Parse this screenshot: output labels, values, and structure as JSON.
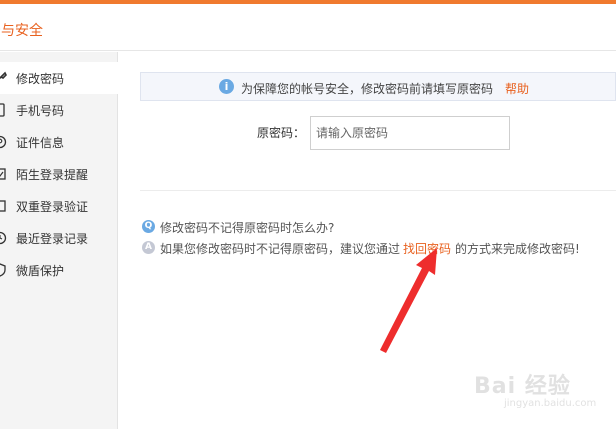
{
  "header": {
    "title": "号与安全"
  },
  "sidebar": {
    "items": [
      {
        "label": "修改密码",
        "icon": "wrench-icon",
        "active": true
      },
      {
        "label": "手机号码",
        "icon": "phone-icon"
      },
      {
        "label": "证件信息",
        "icon": "id-icon"
      },
      {
        "label": "陌生登录提醒",
        "icon": "alert-icon"
      },
      {
        "label": "双重登录验证",
        "icon": "double-verify-icon"
      },
      {
        "label": "最近登录记录",
        "icon": "clock-icon"
      },
      {
        "label": "微盾保护",
        "icon": "shield-icon"
      }
    ]
  },
  "notice": {
    "icon_glyph": "i",
    "text": "为保障您的帐号安全，修改密码前请填写原密码",
    "help_link": "帮助"
  },
  "form": {
    "old_password_label": "原密码：",
    "old_password_placeholder": "请输入原密码",
    "old_password_value": ""
  },
  "faq": {
    "q_badge": "Q",
    "a_badge": "A",
    "question": "修改密码不记得原密码时怎么办?",
    "answer_prefix": "如果您修改密码时不记得原密码，建议您通过",
    "answer_link": "找回密码",
    "answer_suffix": "的方式来完成修改密码!"
  },
  "watermark": {
    "main": "Bai  经验",
    "sub": "jingyan.baidu.com"
  },
  "colors": {
    "accent": "#e8611f",
    "top_bar": "#f07a2e",
    "arrow": "#ee2d2d",
    "info": "#6aa9e3"
  }
}
